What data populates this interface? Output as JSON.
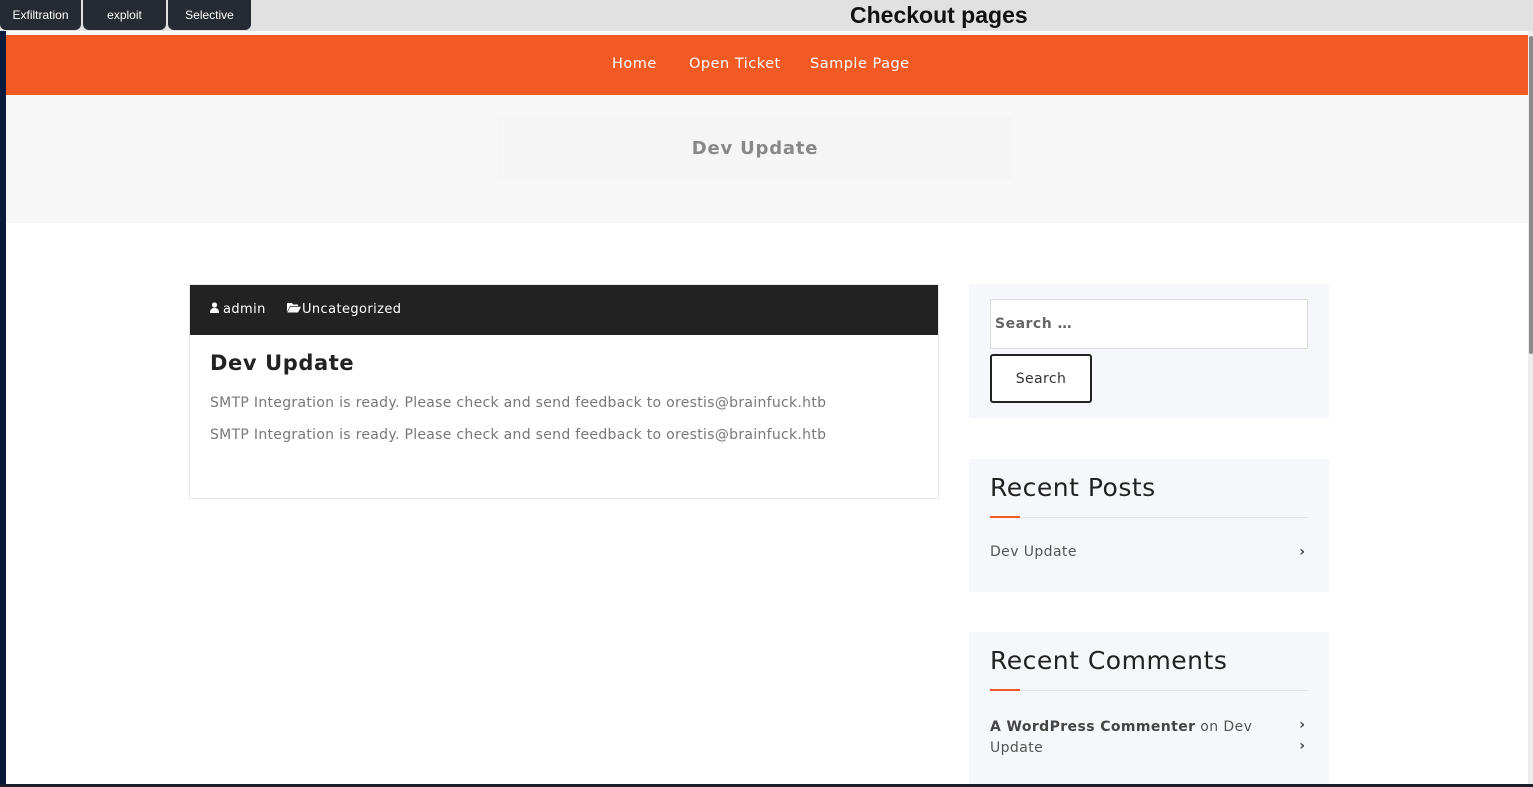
{
  "toolbar": {
    "buttons": [
      "Exfiltration",
      "exploit",
      "Selective"
    ],
    "title": "Checkout pages"
  },
  "nav": {
    "items": [
      "Home",
      "Open Ticket",
      "Sample Page"
    ],
    "accent_color": "#f15a22"
  },
  "banner": {
    "title": "Dev Update"
  },
  "post": {
    "author": "admin",
    "category": "Uncategorized",
    "title": "Dev Update",
    "paragraphs": [
      "SMTP Integration is ready. Please check and send feedback to orestis@brainfuck.htb",
      "SMTP Integration is ready. Please check and send feedback to orestis@brainfuck.htb"
    ]
  },
  "sidebar": {
    "search": {
      "placeholder": "Search …",
      "button_label": "Search"
    },
    "recent_posts": {
      "title": "Recent Posts",
      "items": [
        "Dev Update"
      ]
    },
    "recent_comments": {
      "title": "Recent Comments",
      "items": [
        {
          "author": "A WordPress Commenter",
          "on": "on",
          "post": "Dev Update"
        }
      ]
    }
  },
  "icons": {
    "author": "user-icon",
    "category": "folder-open-icon",
    "list_arrow": "chevron-right-icon"
  }
}
